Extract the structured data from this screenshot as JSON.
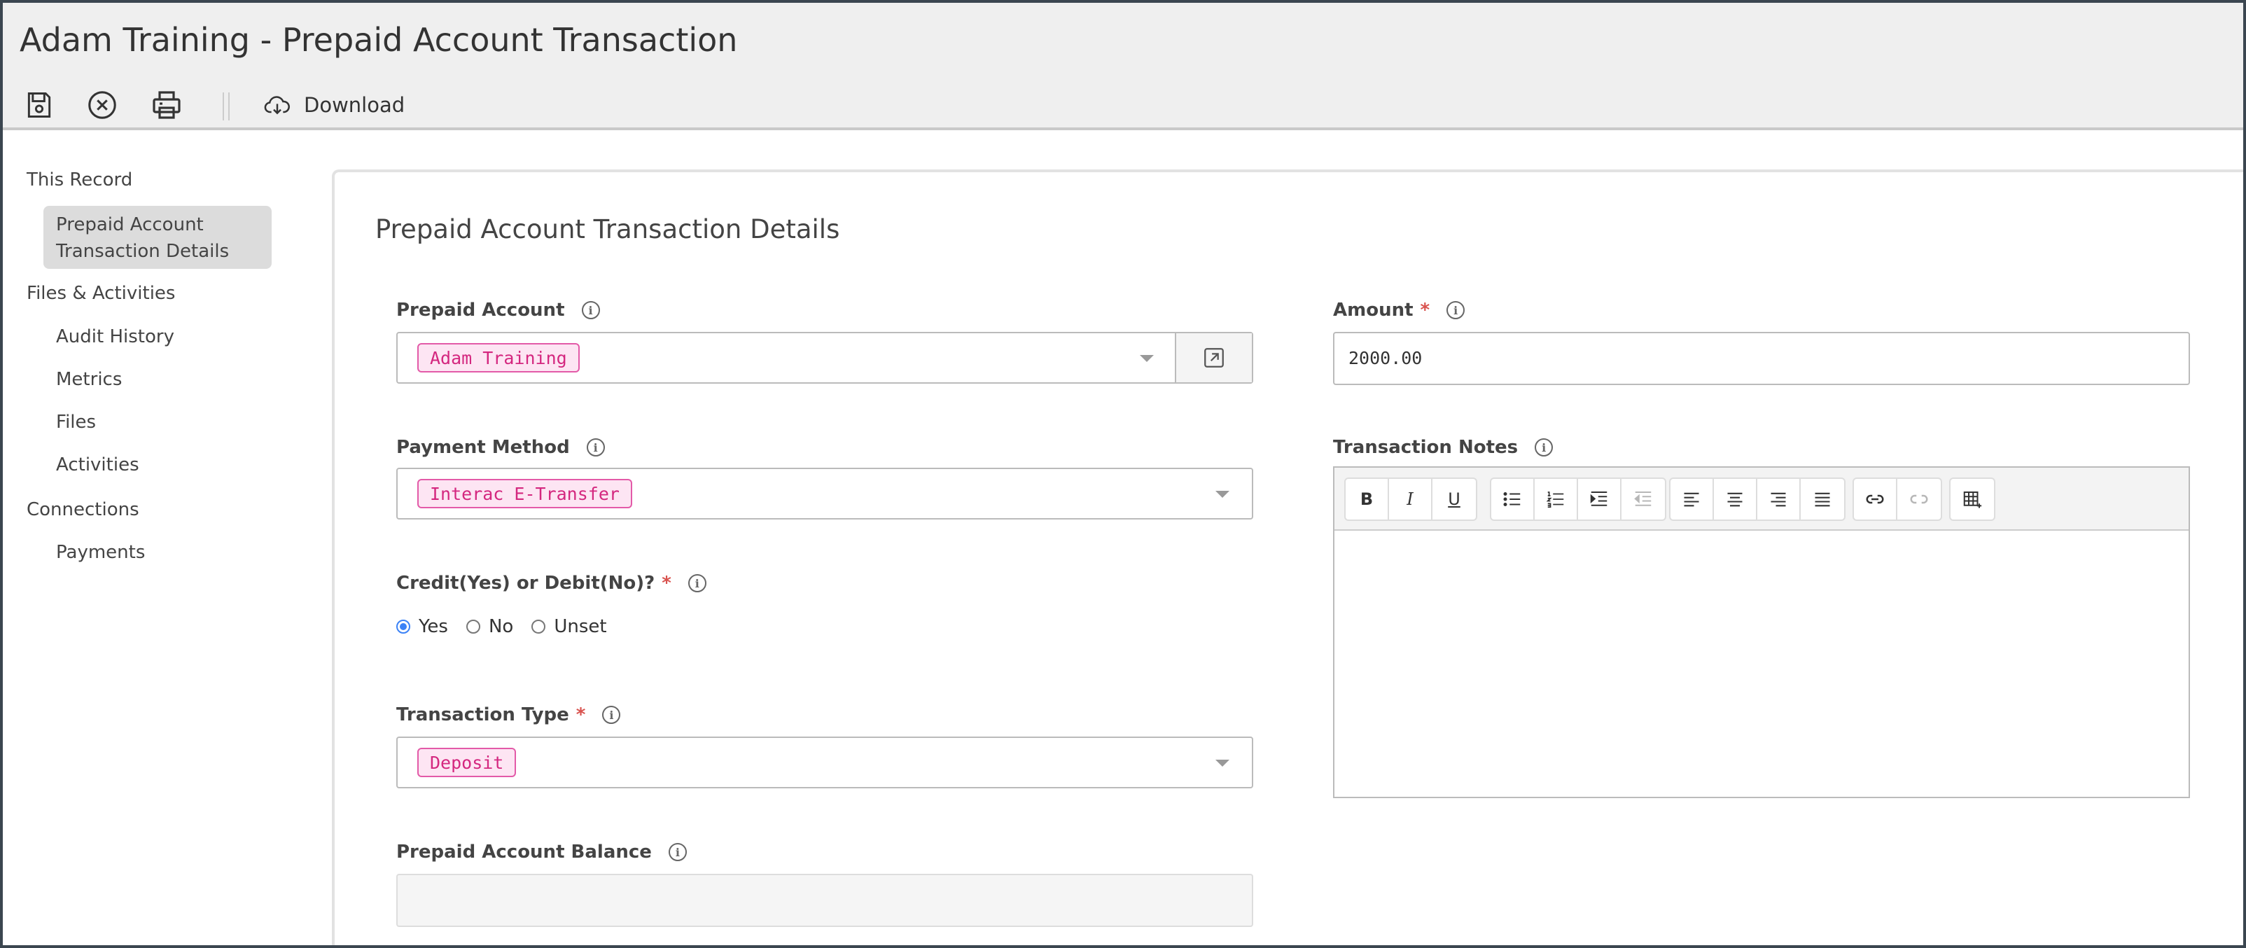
{
  "window": {
    "title": "Adam Training - Prepaid Account Transaction"
  },
  "toolbar": {
    "download_label": "Download"
  },
  "sidebar": {
    "groups": [
      {
        "label": "This Record",
        "items": [
          "Prepaid Account Transaction Details"
        ]
      },
      {
        "label": "Files & Activities",
        "items": [
          "Audit History",
          "Metrics",
          "Files",
          "Activities"
        ]
      },
      {
        "label": "Connections",
        "items": [
          "Payments"
        ]
      }
    ],
    "active_item": "Prepaid Account Transaction Details"
  },
  "main": {
    "section_title": "Prepaid Account Transaction Details",
    "prepaid_account": {
      "label": "Prepaid Account",
      "value": "Adam Training"
    },
    "amount": {
      "label": "Amount",
      "value": "2000.00"
    },
    "payment_method": {
      "label": "Payment Method",
      "value": "Interac E-Transfer"
    },
    "transaction_notes": {
      "label": "Transaction Notes",
      "value": ""
    },
    "credit_debit": {
      "label": "Credit(Yes) or Debit(No)?",
      "options": [
        "Yes",
        "No",
        "Unset"
      ],
      "selected": "Yes"
    },
    "transaction_type": {
      "label": "Transaction Type",
      "value": "Deposit"
    },
    "prepaid_account_balance": {
      "label": "Prepaid Account Balance",
      "value": ""
    }
  },
  "editor_toolbar": {
    "bold": "B",
    "italic": "I",
    "underline": "U"
  },
  "colors": {
    "accent": "#3b82f6",
    "tag_text": "#d4277f",
    "tag_bg": "#fde5f3",
    "required": "#d9534f"
  }
}
